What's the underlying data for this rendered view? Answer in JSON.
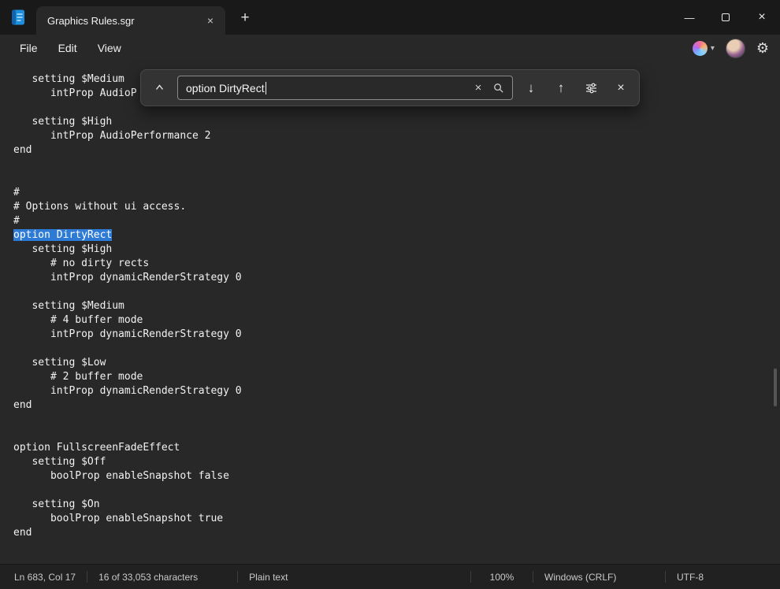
{
  "window": {
    "tab_title": "Graphics Rules.sgr"
  },
  "icons": {
    "minimize": "—",
    "close": "×",
    "tab_close": "×",
    "add_tab": "+",
    "find_next": "↓",
    "find_previous": "↑",
    "clear": "×",
    "close_find": "×",
    "settings": "⚙",
    "copilot_chevron": "▾"
  },
  "menu": {
    "items": [
      "File",
      "Edit",
      "View"
    ]
  },
  "find_bar": {
    "query": "option DirtyRect"
  },
  "editor": {
    "lines": [
      "   setting $Medium",
      "      intProp AudioP",
      "",
      "   setting $High",
      "      intProp AudioPerformance 2",
      "end",
      "",
      "",
      "#",
      "# Options without ui access.",
      "#",
      "option DirtyRect",
      "   setting $High",
      "      # no dirty rects",
      "      intProp dynamicRenderStrategy 0",
      "",
      "   setting $Medium",
      "      # 4 buffer mode",
      "      intProp dynamicRenderStrategy 0",
      "",
      "   setting $Low",
      "      # 2 buffer mode",
      "      intProp dynamicRenderStrategy 0",
      "end",
      "",
      "",
      "option FullscreenFadeEffect",
      "   setting $Off",
      "      boolProp enableSnapshot false",
      "",
      "   setting $On",
      "      boolProp enableSnapshot true",
      "end"
    ],
    "selection": {
      "line_index": 11,
      "text": "option DirtyRect"
    }
  },
  "status_bar": {
    "position": "Ln 683, Col 17",
    "characters": "16 of 33,053 characters",
    "doc_type": "Plain text",
    "zoom": "100%",
    "line_ending": "Windows (CRLF)",
    "encoding": "UTF-8"
  },
  "colors": {
    "selection": "#2e7bd6"
  }
}
